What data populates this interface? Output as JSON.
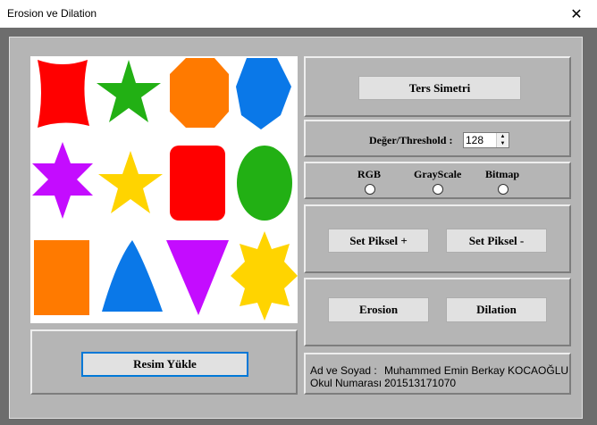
{
  "window": {
    "title": "Erosion ve Dilation",
    "close_glyph": "✕"
  },
  "buttons": {
    "ters_simetri": "Ters Simetri",
    "set_piksel_plus": "Set Piksel +",
    "set_piksel_minus": "Set Piksel -",
    "erosion": "Erosion",
    "dilation": "Dilation",
    "resim_yukle": "Resim Yükle"
  },
  "threshold": {
    "label": "Değer/Threshold :",
    "value": "128"
  },
  "radios": [
    {
      "label": "RGB",
      "checked": false
    },
    {
      "label": "GrayScale",
      "checked": false
    },
    {
      "label": "Bitmap",
      "checked": false
    }
  ],
  "info": {
    "name_label": "Ad ve Soyad :",
    "name_value": "Muhammed Emin Berkay KOCAOĞLU",
    "number_label": "Okul Numarası :",
    "number_value": "201513171070"
  },
  "colors": {
    "red": "#ff0000",
    "green": "#22b014",
    "orange": "#ff7a00",
    "blue": "#0a78e8",
    "purple": "#c40cff",
    "yellow": "#ffd400"
  },
  "image": {
    "shapes": [
      {
        "name": "red-star4-shape",
        "color": "red"
      },
      {
        "name": "green-star5-shape",
        "color": "green"
      },
      {
        "name": "orange-octagon-shape",
        "color": "orange"
      },
      {
        "name": "blue-heptagon-shape",
        "color": "blue"
      },
      {
        "name": "purple-star6-shape",
        "color": "purple"
      },
      {
        "name": "yellow-star5-shape",
        "color": "yellow"
      },
      {
        "name": "red-rounded-rect-shape",
        "color": "red"
      },
      {
        "name": "green-ellipse-shape",
        "color": "green"
      },
      {
        "name": "orange-rect-shape",
        "color": "orange"
      },
      {
        "name": "blue-triangle-shape",
        "color": "blue"
      },
      {
        "name": "purple-inverted-triangle-shape",
        "color": "purple"
      },
      {
        "name": "yellow-star8-shape",
        "color": "yellow"
      }
    ]
  }
}
